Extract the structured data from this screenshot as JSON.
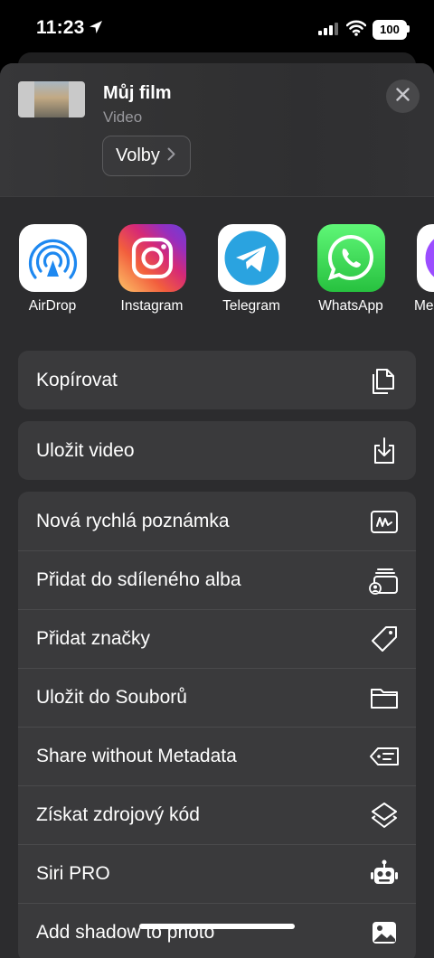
{
  "status": {
    "time": "11:23",
    "battery": "100"
  },
  "header": {
    "title": "Můj film",
    "subtitle": "Video",
    "options_label": "Volby"
  },
  "apps": [
    {
      "label": "AirDrop",
      "icon": "airdrop-icon"
    },
    {
      "label": "Instagram",
      "icon": "instagram-icon"
    },
    {
      "label": "Telegram",
      "icon": "telegram-icon"
    },
    {
      "label": "WhatsApp",
      "icon": "whatsapp-icon"
    },
    {
      "label": "Me",
      "icon": "messenger-icon"
    }
  ],
  "actions_group1": [
    {
      "label": "Kopírovat",
      "icon": "copy-icon"
    }
  ],
  "actions_group2": [
    {
      "label": "Uložit video",
      "icon": "save-download-icon"
    }
  ],
  "actions_group3": [
    {
      "label": "Nová rychlá poznámka",
      "icon": "quick-note-icon"
    },
    {
      "label": "Přidat do sdíleného alba",
      "icon": "shared-album-icon"
    },
    {
      "label": "Přidat značky",
      "icon": "tag-icon"
    },
    {
      "label": "Uložit do Souborů",
      "icon": "folder-icon"
    },
    {
      "label": "Share without Metadata",
      "icon": "metadata-tag-icon"
    },
    {
      "label": "Získat zdrojový kód",
      "icon": "layers-icon"
    },
    {
      "label": "Siri PRO",
      "icon": "robot-icon"
    },
    {
      "label": "Add shadow to photo",
      "icon": "photo-icon"
    }
  ],
  "colors": {
    "sheet_bg": "#2c2c2e",
    "row_bg": "#3a3a3c",
    "airdrop_blue": "#1e88f0",
    "telegram_blue": "#2aa3e0",
    "whatsapp_green": "#2fd158"
  }
}
